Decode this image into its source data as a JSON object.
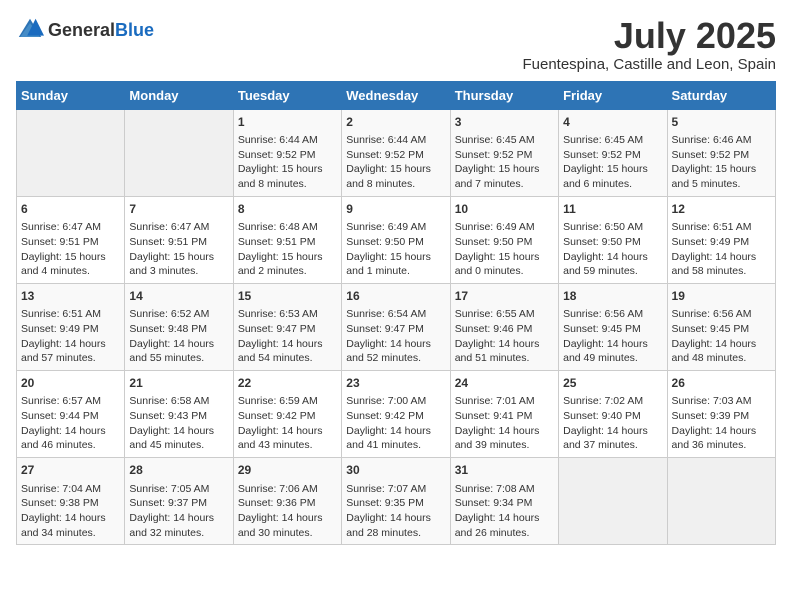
{
  "logo": {
    "text_general": "General",
    "text_blue": "Blue"
  },
  "title": "July 2025",
  "subtitle": "Fuentespina, Castille and Leon, Spain",
  "days_of_week": [
    "Sunday",
    "Monday",
    "Tuesday",
    "Wednesday",
    "Thursday",
    "Friday",
    "Saturday"
  ],
  "weeks": [
    [
      {
        "day": "",
        "info": ""
      },
      {
        "day": "",
        "info": ""
      },
      {
        "day": "1",
        "info": "Sunrise: 6:44 AM\nSunset: 9:52 PM\nDaylight: 15 hours and 8 minutes."
      },
      {
        "day": "2",
        "info": "Sunrise: 6:44 AM\nSunset: 9:52 PM\nDaylight: 15 hours and 8 minutes."
      },
      {
        "day": "3",
        "info": "Sunrise: 6:45 AM\nSunset: 9:52 PM\nDaylight: 15 hours and 7 minutes."
      },
      {
        "day": "4",
        "info": "Sunrise: 6:45 AM\nSunset: 9:52 PM\nDaylight: 15 hours and 6 minutes."
      },
      {
        "day": "5",
        "info": "Sunrise: 6:46 AM\nSunset: 9:52 PM\nDaylight: 15 hours and 5 minutes."
      }
    ],
    [
      {
        "day": "6",
        "info": "Sunrise: 6:47 AM\nSunset: 9:51 PM\nDaylight: 15 hours and 4 minutes."
      },
      {
        "day": "7",
        "info": "Sunrise: 6:47 AM\nSunset: 9:51 PM\nDaylight: 15 hours and 3 minutes."
      },
      {
        "day": "8",
        "info": "Sunrise: 6:48 AM\nSunset: 9:51 PM\nDaylight: 15 hours and 2 minutes."
      },
      {
        "day": "9",
        "info": "Sunrise: 6:49 AM\nSunset: 9:50 PM\nDaylight: 15 hours and 1 minute."
      },
      {
        "day": "10",
        "info": "Sunrise: 6:49 AM\nSunset: 9:50 PM\nDaylight: 15 hours and 0 minutes."
      },
      {
        "day": "11",
        "info": "Sunrise: 6:50 AM\nSunset: 9:50 PM\nDaylight: 14 hours and 59 minutes."
      },
      {
        "day": "12",
        "info": "Sunrise: 6:51 AM\nSunset: 9:49 PM\nDaylight: 14 hours and 58 minutes."
      }
    ],
    [
      {
        "day": "13",
        "info": "Sunrise: 6:51 AM\nSunset: 9:49 PM\nDaylight: 14 hours and 57 minutes."
      },
      {
        "day": "14",
        "info": "Sunrise: 6:52 AM\nSunset: 9:48 PM\nDaylight: 14 hours and 55 minutes."
      },
      {
        "day": "15",
        "info": "Sunrise: 6:53 AM\nSunset: 9:47 PM\nDaylight: 14 hours and 54 minutes."
      },
      {
        "day": "16",
        "info": "Sunrise: 6:54 AM\nSunset: 9:47 PM\nDaylight: 14 hours and 52 minutes."
      },
      {
        "day": "17",
        "info": "Sunrise: 6:55 AM\nSunset: 9:46 PM\nDaylight: 14 hours and 51 minutes."
      },
      {
        "day": "18",
        "info": "Sunrise: 6:56 AM\nSunset: 9:45 PM\nDaylight: 14 hours and 49 minutes."
      },
      {
        "day": "19",
        "info": "Sunrise: 6:56 AM\nSunset: 9:45 PM\nDaylight: 14 hours and 48 minutes."
      }
    ],
    [
      {
        "day": "20",
        "info": "Sunrise: 6:57 AM\nSunset: 9:44 PM\nDaylight: 14 hours and 46 minutes."
      },
      {
        "day": "21",
        "info": "Sunrise: 6:58 AM\nSunset: 9:43 PM\nDaylight: 14 hours and 45 minutes."
      },
      {
        "day": "22",
        "info": "Sunrise: 6:59 AM\nSunset: 9:42 PM\nDaylight: 14 hours and 43 minutes."
      },
      {
        "day": "23",
        "info": "Sunrise: 7:00 AM\nSunset: 9:42 PM\nDaylight: 14 hours and 41 minutes."
      },
      {
        "day": "24",
        "info": "Sunrise: 7:01 AM\nSunset: 9:41 PM\nDaylight: 14 hours and 39 minutes."
      },
      {
        "day": "25",
        "info": "Sunrise: 7:02 AM\nSunset: 9:40 PM\nDaylight: 14 hours and 37 minutes."
      },
      {
        "day": "26",
        "info": "Sunrise: 7:03 AM\nSunset: 9:39 PM\nDaylight: 14 hours and 36 minutes."
      }
    ],
    [
      {
        "day": "27",
        "info": "Sunrise: 7:04 AM\nSunset: 9:38 PM\nDaylight: 14 hours and 34 minutes."
      },
      {
        "day": "28",
        "info": "Sunrise: 7:05 AM\nSunset: 9:37 PM\nDaylight: 14 hours and 32 minutes."
      },
      {
        "day": "29",
        "info": "Sunrise: 7:06 AM\nSunset: 9:36 PM\nDaylight: 14 hours and 30 minutes."
      },
      {
        "day": "30",
        "info": "Sunrise: 7:07 AM\nSunset: 9:35 PM\nDaylight: 14 hours and 28 minutes."
      },
      {
        "day": "31",
        "info": "Sunrise: 7:08 AM\nSunset: 9:34 PM\nDaylight: 14 hours and 26 minutes."
      },
      {
        "day": "",
        "info": ""
      },
      {
        "day": "",
        "info": ""
      }
    ]
  ]
}
